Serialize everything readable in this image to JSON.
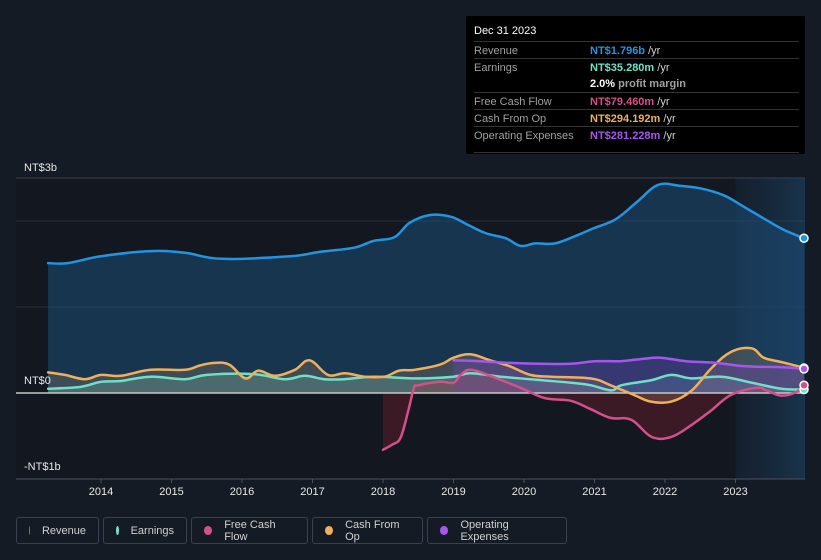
{
  "tooltip": {
    "date": "Dec 31 2023",
    "rows": [
      {
        "label": "Revenue",
        "value": "NT$1.796b",
        "unit": " /yr",
        "color": "#2394df"
      },
      {
        "label": "Earnings",
        "value": "NT$35.280m",
        "unit": " /yr",
        "color": "#6ee0c8"
      },
      {
        "label": "",
        "margin_value": "2.0%",
        "margin_label": " profit margin"
      },
      {
        "label": "Free Cash Flow",
        "value": "NT$79.460m",
        "unit": " /yr",
        "color": "#d4508a"
      },
      {
        "label": "Cash From Op",
        "value": "NT$294.192m",
        "unit": " /yr",
        "color": "#f0b05a"
      },
      {
        "label": "Operating Expenses",
        "value": "NT$281.228m",
        "unit": " /yr",
        "color": "#a855f0"
      }
    ]
  },
  "legend": [
    {
      "label": "Revenue",
      "color": "#2394df"
    },
    {
      "label": "Earnings",
      "color": "#6ee0c8"
    },
    {
      "label": "Free Cash Flow",
      "color": "#d4508a"
    },
    {
      "label": "Cash From Op",
      "color": "#f0b05a"
    },
    {
      "label": "Operating Expenses",
      "color": "#a855f0"
    }
  ],
  "chart_data": {
    "type": "area",
    "title": "",
    "xlabel": "",
    "ylabel": "",
    "currency": "NT$",
    "y_unit": "billions",
    "ylim": [
      -1,
      2.5
    ],
    "xlim": [
      2013.25,
      2024.0
    ],
    "y_tick_labels": [
      {
        "value": 3,
        "label": "NT$3b"
      },
      {
        "value": 0,
        "label": "NT$0"
      },
      {
        "value": -1,
        "label": "-NT$1b"
      }
    ],
    "x_tick_labels": [
      "2014",
      "2015",
      "2016",
      "2017",
      "2018",
      "2019",
      "2020",
      "2021",
      "2022",
      "2023"
    ],
    "x_ticks": [
      2014,
      2015,
      2016,
      2017,
      2018,
      2019,
      2020,
      2021,
      2022,
      2023
    ],
    "gridlines": [
      1,
      2
    ],
    "highlight_from": 2023.0,
    "grid": true,
    "legend_position": "bottom",
    "series": [
      {
        "name": "Revenue",
        "color": "#2394df",
        "x": [
          2013.25,
          2013.53,
          2014.0,
          2014.7,
          2015.19,
          2015.71,
          2016.68,
          2017.09,
          2017.59,
          2017.87,
          2018.16,
          2018.38,
          2018.67,
          2018.96,
          2019.17,
          2019.45,
          2019.74,
          2019.95,
          2020.16,
          2020.44,
          2020.77,
          2021.0,
          2021.3,
          2021.6,
          2021.9,
          2022.2,
          2022.5,
          2022.83,
          2023.11,
          2023.4,
          2023.68,
          2024.0
        ],
        "values": [
          1.51,
          1.51,
          1.59,
          1.65,
          1.63,
          1.56,
          1.59,
          1.64,
          1.69,
          1.77,
          1.81,
          1.98,
          2.07,
          2.05,
          1.97,
          1.86,
          1.8,
          1.71,
          1.74,
          1.74,
          1.84,
          1.92,
          2.02,
          2.22,
          2.42,
          2.41,
          2.38,
          2.3,
          2.17,
          2.03,
          1.9,
          1.8
        ]
      },
      {
        "name": "Earnings",
        "color": "#6ee0c8",
        "x": [
          2013.25,
          2013.7,
          2014.0,
          2014.28,
          2014.7,
          2015.19,
          2015.5,
          2016.16,
          2016.6,
          2016.89,
          2017.17,
          2017.45,
          2017.87,
          2018.45,
          2019.0,
          2019.24,
          2019.67,
          2020.24,
          2020.67,
          2020.95,
          2021.24,
          2021.38,
          2021.81,
          2022.09,
          2022.38,
          2022.8,
          2023.23,
          2023.65,
          2024.0
        ],
        "values": [
          0.05,
          0.07,
          0.13,
          0.14,
          0.19,
          0.16,
          0.21,
          0.22,
          0.16,
          0.2,
          0.16,
          0.16,
          0.19,
          0.17,
          0.19,
          0.23,
          0.19,
          0.15,
          0.12,
          0.09,
          0.03,
          0.09,
          0.15,
          0.21,
          0.17,
          0.19,
          0.12,
          0.05,
          0.04
        ]
      },
      {
        "name": "Free Cash Flow",
        "color": "#d4508a",
        "x": [
          2018.0,
          2018.13,
          2018.25,
          2018.36,
          2018.44,
          2018.5,
          2018.81,
          2019.0,
          2019.1,
          2019.24,
          2019.52,
          2019.95,
          2020.3,
          2020.66,
          2020.95,
          2021.23,
          2021.52,
          2021.81,
          2022.09,
          2022.38,
          2022.66,
          2022.94,
          2023.3,
          2023.44,
          2023.65,
          2023.86,
          2024.0
        ],
        "values": [
          -0.66,
          -0.6,
          -0.52,
          -0.2,
          0.06,
          0.09,
          0.13,
          0.12,
          0.21,
          0.27,
          0.2,
          0.06,
          -0.06,
          -0.09,
          -0.19,
          -0.29,
          -0.31,
          -0.51,
          -0.51,
          -0.37,
          -0.2,
          -0.02,
          0.06,
          0.03,
          -0.03,
          0.01,
          0.09
        ]
      },
      {
        "name": "Cash From Op",
        "color": "#f0b05a",
        "x": [
          2013.25,
          2013.49,
          2013.77,
          2014.0,
          2014.28,
          2014.7,
          2015.19,
          2015.4,
          2015.61,
          2015.82,
          2016.05,
          2016.23,
          2016.47,
          2016.75,
          2016.96,
          2017.22,
          2017.46,
          2017.74,
          2018.02,
          2018.23,
          2018.45,
          2018.81,
          2019.0,
          2019.24,
          2019.52,
          2019.8,
          2020.09,
          2020.38,
          2020.94,
          2021.23,
          2021.58,
          2021.8,
          2022.09,
          2022.38,
          2022.66,
          2022.94,
          2023.23,
          2023.4,
          2023.65,
          2023.94,
          2024.0
        ],
        "values": [
          0.24,
          0.21,
          0.16,
          0.21,
          0.2,
          0.27,
          0.27,
          0.32,
          0.35,
          0.33,
          0.17,
          0.26,
          0.2,
          0.27,
          0.38,
          0.21,
          0.23,
          0.19,
          0.19,
          0.26,
          0.27,
          0.33,
          0.41,
          0.45,
          0.38,
          0.31,
          0.21,
          0.19,
          0.17,
          0.09,
          -0.03,
          -0.1,
          -0.1,
          0.03,
          0.29,
          0.48,
          0.52,
          0.41,
          0.36,
          0.3,
          0.29
        ]
      },
      {
        "name": "Operating Expenses",
        "color": "#a855f0",
        "x": [
          2019.0,
          2019.38,
          2019.8,
          2020.23,
          2020.66,
          2021.01,
          2021.37,
          2021.72,
          2021.94,
          2022.3,
          2022.72,
          2023.14,
          2023.68,
          2024.0
        ],
        "values": [
          0.38,
          0.37,
          0.35,
          0.34,
          0.34,
          0.37,
          0.37,
          0.4,
          0.41,
          0.37,
          0.35,
          0.31,
          0.3,
          0.28
        ]
      }
    ]
  }
}
